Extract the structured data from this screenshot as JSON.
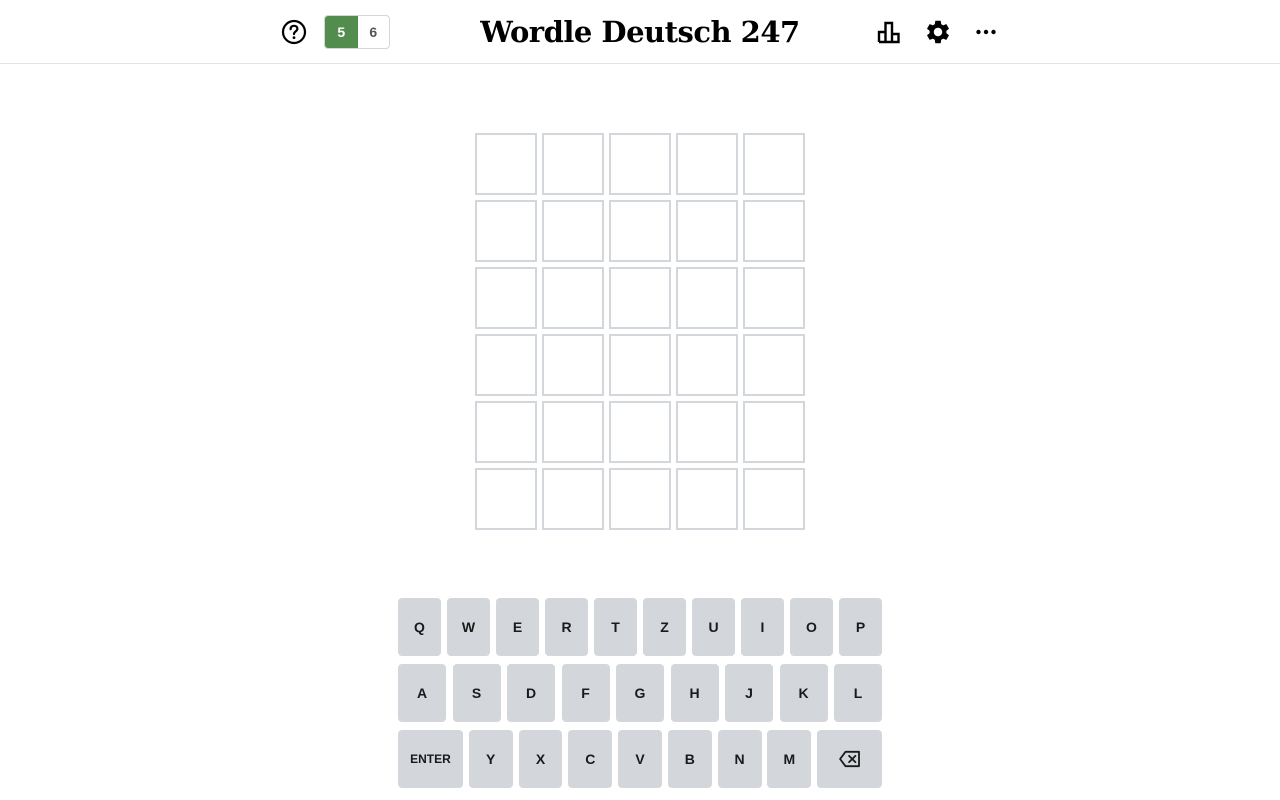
{
  "header": {
    "title": "Wordle Deutsch 247",
    "help_icon": "question-circle-icon",
    "stats_icon": "bar-chart-icon",
    "settings_icon": "gear-icon",
    "more_icon": "more-dots-icon",
    "mode_toggle": [
      {
        "label": "5",
        "active": true
      },
      {
        "label": "6",
        "active": false
      }
    ]
  },
  "board": {
    "rows": 6,
    "cols": 5,
    "letters": [
      [
        "",
        "",
        "",
        "",
        ""
      ],
      [
        "",
        "",
        "",
        "",
        ""
      ],
      [
        "",
        "",
        "",
        "",
        ""
      ],
      [
        "",
        "",
        "",
        "",
        ""
      ],
      [
        "",
        "",
        "",
        "",
        ""
      ],
      [
        "",
        "",
        "",
        "",
        ""
      ]
    ]
  },
  "keyboard": {
    "row1": [
      "Q",
      "W",
      "E",
      "R",
      "T",
      "Z",
      "U",
      "I",
      "O",
      "P"
    ],
    "row2": [
      "A",
      "S",
      "D",
      "F",
      "G",
      "H",
      "J",
      "K",
      "L"
    ],
    "row3_enter": "ENTER",
    "row3": [
      "Y",
      "X",
      "C",
      "V",
      "B",
      "N",
      "M"
    ],
    "backspace_icon": "backspace-icon"
  },
  "colors": {
    "accent_green": "#538d4e",
    "key_bg": "#d3d6da",
    "tile_border": "#d3d6da"
  }
}
